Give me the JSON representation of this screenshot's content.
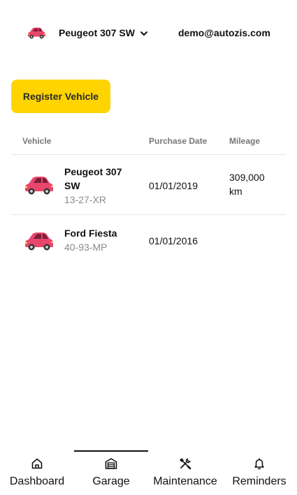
{
  "header": {
    "selected_vehicle": "Peugeot 307 SW",
    "vehicle_icon": "car-icon",
    "user_email": "demo@autozis.com"
  },
  "actions": {
    "register_label": "Register Vehicle"
  },
  "table": {
    "columns": [
      "Vehicle",
      "Purchase Date",
      "Mileage"
    ],
    "rows": [
      {
        "name": "Peugeot 307 SW",
        "plate": "13-27-XR",
        "purchase_date": "01/01/2019",
        "mileage": "309,000 km"
      },
      {
        "name": "Ford Fiesta",
        "plate": "40-93-MP",
        "purchase_date": "01/01/2016",
        "mileage": ""
      }
    ]
  },
  "nav": {
    "items": [
      {
        "label": "Dashboard",
        "icon": "home-icon"
      },
      {
        "label": "Garage",
        "icon": "garage-icon",
        "active": true
      },
      {
        "label": "Maintenance",
        "icon": "tools-icon"
      },
      {
        "label": "Reminders",
        "icon": "bell-icon"
      }
    ]
  },
  "colors": {
    "accent": "#FFD400",
    "car_body": "#E8476B",
    "text": "#111111",
    "muted": "#8A8A8A"
  }
}
